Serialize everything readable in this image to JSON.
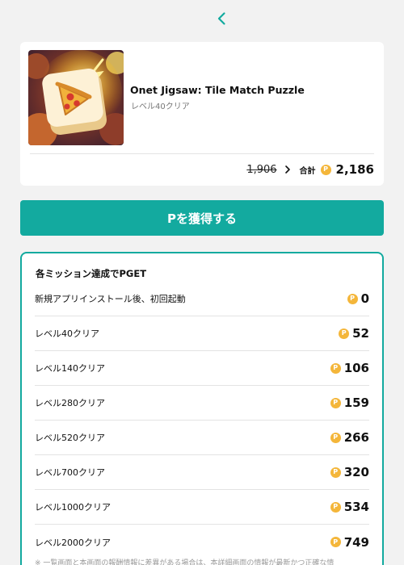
{
  "header": {
    "back_icon": "chevron-left-icon",
    "accent_color": "#13aa9f"
  },
  "app": {
    "title": "Onet Jigsaw: Tile Match Puzzle",
    "subtitle": "レベル40クリア",
    "thumbnail_icon": "pizza-tile-icon",
    "old_points": "1,906",
    "total_label": "合計",
    "coin_symbol": "P",
    "total_points": "2,186"
  },
  "primary_button": {
    "label": "Pを獲得する",
    "color": "#13aa9f"
  },
  "missions": {
    "heading": "各ミッション達成でPGET",
    "coin_color": "#f4b63a",
    "items": [
      {
        "label": "新規アプリインストール後、初回起動",
        "points": "0"
      },
      {
        "label": "レベル40クリア",
        "points": "52"
      },
      {
        "label": "レベル140クリア",
        "points": "106"
      },
      {
        "label": "レベル280クリア",
        "points": "159"
      },
      {
        "label": "レベル520クリア",
        "points": "266"
      },
      {
        "label": "レベル700クリア",
        "points": "320"
      },
      {
        "label": "レベル1000クリア",
        "points": "534"
      },
      {
        "label": "レベル2000クリア",
        "points": "749"
      }
    ],
    "footnote": "※ 一覧画面と本画面の報酬情報に差異がある場合は、本詳細画面の情報が最新かつ正確な情"
  }
}
